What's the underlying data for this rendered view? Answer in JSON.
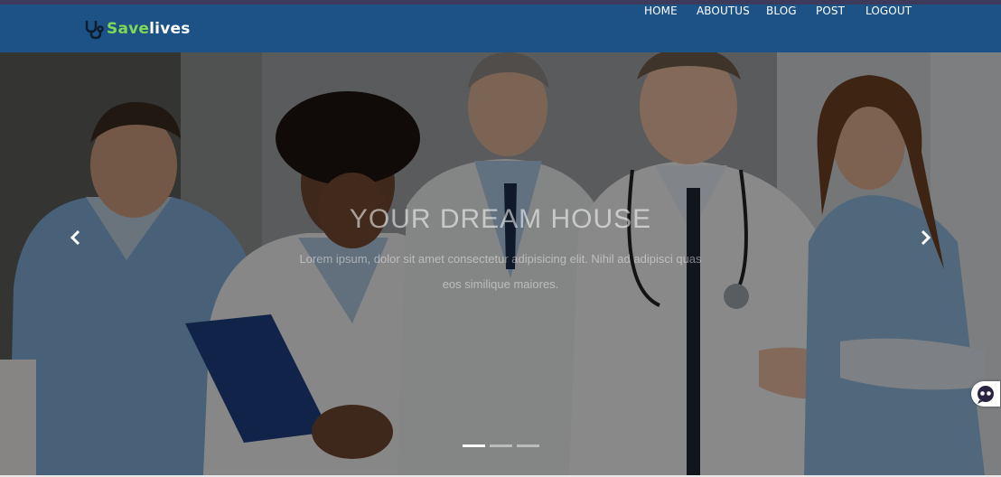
{
  "brand": {
    "name_part1": "Save",
    "name_part2": "lives",
    "icon": "stethoscope-icon",
    "color_part1": "#7ed957",
    "color_part2": "#ffffff"
  },
  "nav": {
    "items": [
      "HOME",
      "ABOUTUS",
      "BLOG",
      "POST",
      "LOGOUT"
    ],
    "background": "#1c5285"
  },
  "carousel": {
    "slide_image": "doctors-group-photo",
    "caption_title": "YOUR DREAM HOUSE",
    "caption_text": "Lorem ipsum, dolor sit amet consectetur adipisicing elit. Nihil ad adipisci quas eos similique maiores.",
    "prev_icon": "chevron-left-icon",
    "next_icon": "chevron-right-icon",
    "active_slide": 1,
    "slide_count": 3
  },
  "widget": {
    "icon": "chat-bot-icon"
  }
}
